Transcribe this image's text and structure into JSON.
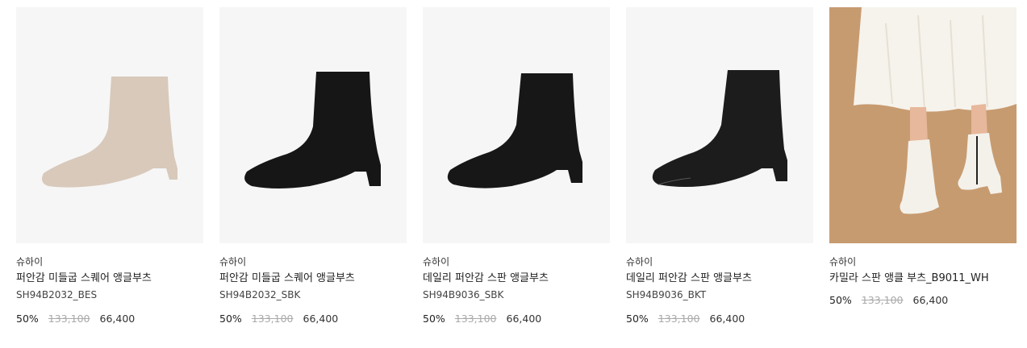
{
  "products": [
    {
      "brand": "슈하이",
      "title": "퍼안감 미들굽 스퀘어 앵글부츠",
      "code": "SH94B2032_BES",
      "discount": "50%",
      "original_price": "133,100",
      "sale_price": "66,400",
      "boot_color": "#d8c9bb"
    },
    {
      "brand": "슈하이",
      "title": "퍼안감 미들굽 스퀘어 앵글부츠",
      "code": "SH94B2032_SBK",
      "discount": "50%",
      "original_price": "133,100",
      "sale_price": "66,400",
      "boot_color": "#161616"
    },
    {
      "brand": "슈하이",
      "title": "데일리 퍼안감 스판 앵글부츠",
      "code": "SH94B9036_SBK",
      "discount": "50%",
      "original_price": "133,100",
      "sale_price": "66,400",
      "boot_color": "#171717"
    },
    {
      "brand": "슈하이",
      "title": "데일리 퍼안감 스판 앵글부츠",
      "code": "SH94B9036_BKT",
      "discount": "50%",
      "original_price": "133,100",
      "sale_price": "66,400",
      "boot_color": "#1c1c1c"
    },
    {
      "brand": "슈하이",
      "title": "카밀라 스판 앵클 부츠_B9011_WH",
      "code": "",
      "discount": "50%",
      "original_price": "133,100",
      "sale_price": "66,400",
      "boot_color": "#f4f1ea"
    }
  ]
}
